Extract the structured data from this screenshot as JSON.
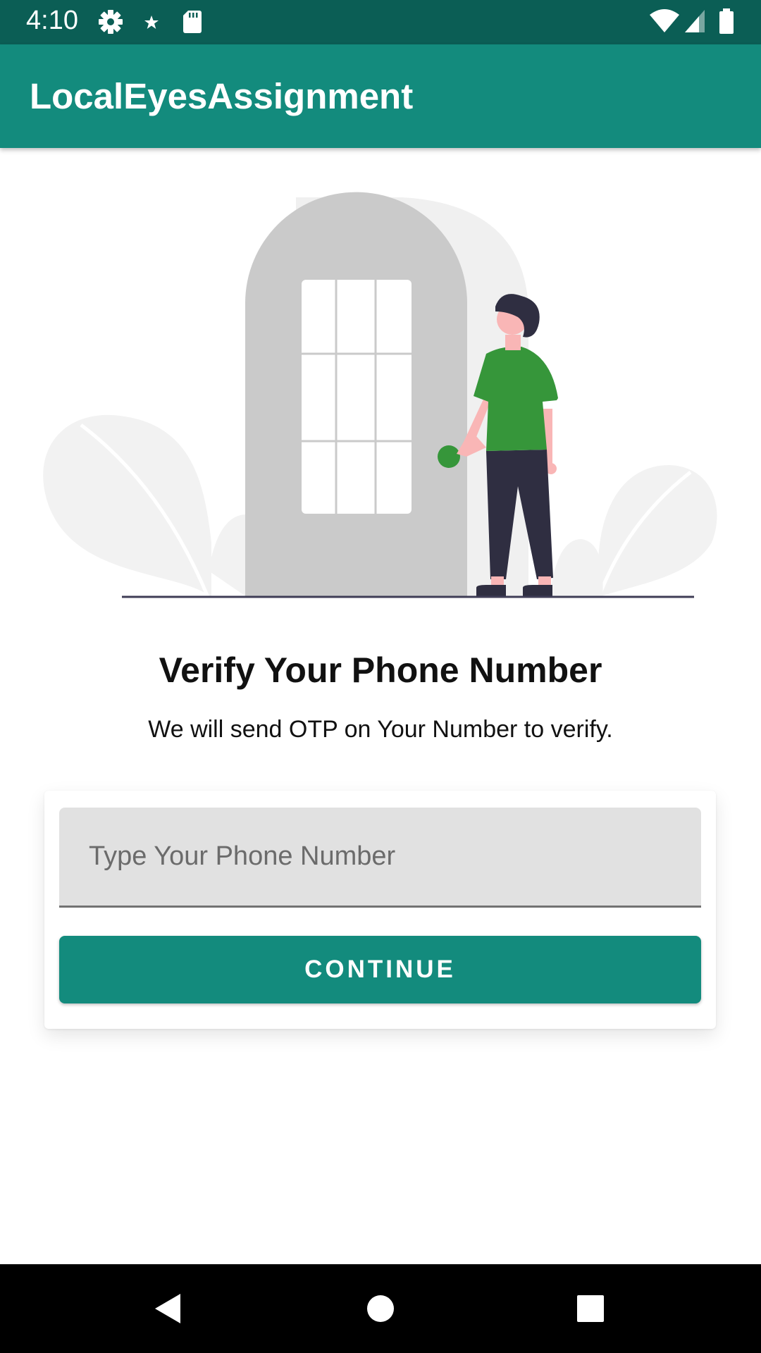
{
  "status_bar": {
    "time": "4:10",
    "left_icons": [
      "gear-icon",
      "star-icon",
      "sd-card-icon"
    ],
    "right_icons": [
      "wifi-icon",
      "signal-icon",
      "battery-icon"
    ]
  },
  "app_bar": {
    "title": "LocalEyesAssignment",
    "color": "#138b7d"
  },
  "main": {
    "headline": "Verify Your Phone Number",
    "subtitle": "We will send OTP on Your Number to verify.",
    "phone_input": {
      "placeholder": "Type Your Phone Number",
      "value": ""
    },
    "continue_label": "CONTINUE"
  },
  "nav_bar": {
    "buttons": [
      "back-icon",
      "home-icon",
      "recents-icon"
    ]
  },
  "colors": {
    "status_bar": "#0b5e55",
    "accent": "#138b7d",
    "shirt": "#36963a"
  }
}
